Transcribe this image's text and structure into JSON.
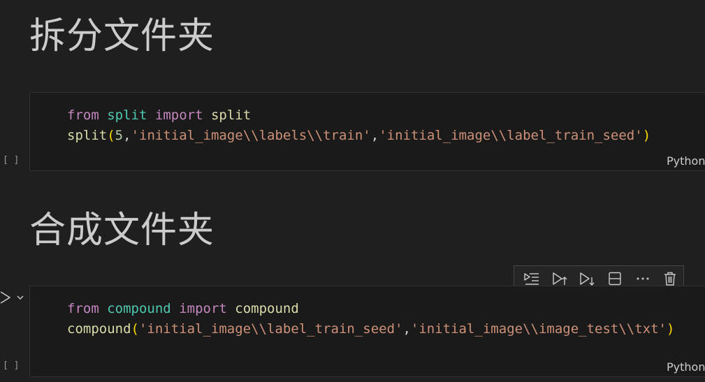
{
  "sections": [
    {
      "heading": "拆分文件夹",
      "cell": {
        "exec_count": "[ ]",
        "language": "Python",
        "lines": [
          [
            {
              "t": "from",
              "c": "kw"
            },
            {
              "t": " ",
              "c": "pun"
            },
            {
              "t": "split",
              "c": "mod"
            },
            {
              "t": " ",
              "c": "pun"
            },
            {
              "t": "import",
              "c": "kw"
            },
            {
              "t": " ",
              "c": "pun"
            },
            {
              "t": "split",
              "c": "fn"
            }
          ],
          [
            {
              "t": "split",
              "c": "fn"
            },
            {
              "t": "(",
              "c": "par"
            },
            {
              "t": "5",
              "c": "num"
            },
            {
              "t": ",",
              "c": "pun"
            },
            {
              "t": "'initial_image\\\\labels\\\\train'",
              "c": "str"
            },
            {
              "t": ",",
              "c": "pun"
            },
            {
              "t": "'initial_image\\\\label_train_seed'",
              "c": "str"
            },
            {
              "t": ")",
              "c": "par"
            }
          ]
        ]
      }
    },
    {
      "heading": "合成文件夹",
      "cell": {
        "exec_count": "[ ]",
        "language": "Python",
        "lines": [
          [
            {
              "t": "from",
              "c": "kw"
            },
            {
              "t": " ",
              "c": "pun"
            },
            {
              "t": "compound",
              "c": "mod"
            },
            {
              "t": " ",
              "c": "pun"
            },
            {
              "t": "import",
              "c": "kw"
            },
            {
              "t": " ",
              "c": "pun"
            },
            {
              "t": "compound",
              "c": "fn"
            }
          ],
          [
            {
              "t": "compound",
              "c": "fn"
            },
            {
              "t": "(",
              "c": "par"
            },
            {
              "t": "'initial_image\\\\label_train_seed'",
              "c": "str"
            },
            {
              "t": ",",
              "c": "pun"
            },
            {
              "t": "'initial_image\\\\image_test\\\\txt'",
              "c": "str"
            },
            {
              "t": ")",
              "c": "par"
            }
          ]
        ]
      }
    }
  ],
  "cell_toolbar": {
    "icons": [
      "run-by-line-icon",
      "execute-above-icon",
      "execute-below-icon",
      "split-cell-icon",
      "more-actions-icon",
      "delete-cell-icon"
    ]
  },
  "colors": {
    "background": "#1f1f1f",
    "keyword": "#c586c0",
    "module": "#4ec9b0",
    "function": "#dcdcaa",
    "string": "#ce9178",
    "number": "#b5cea8",
    "bracket": "#ffd700"
  }
}
